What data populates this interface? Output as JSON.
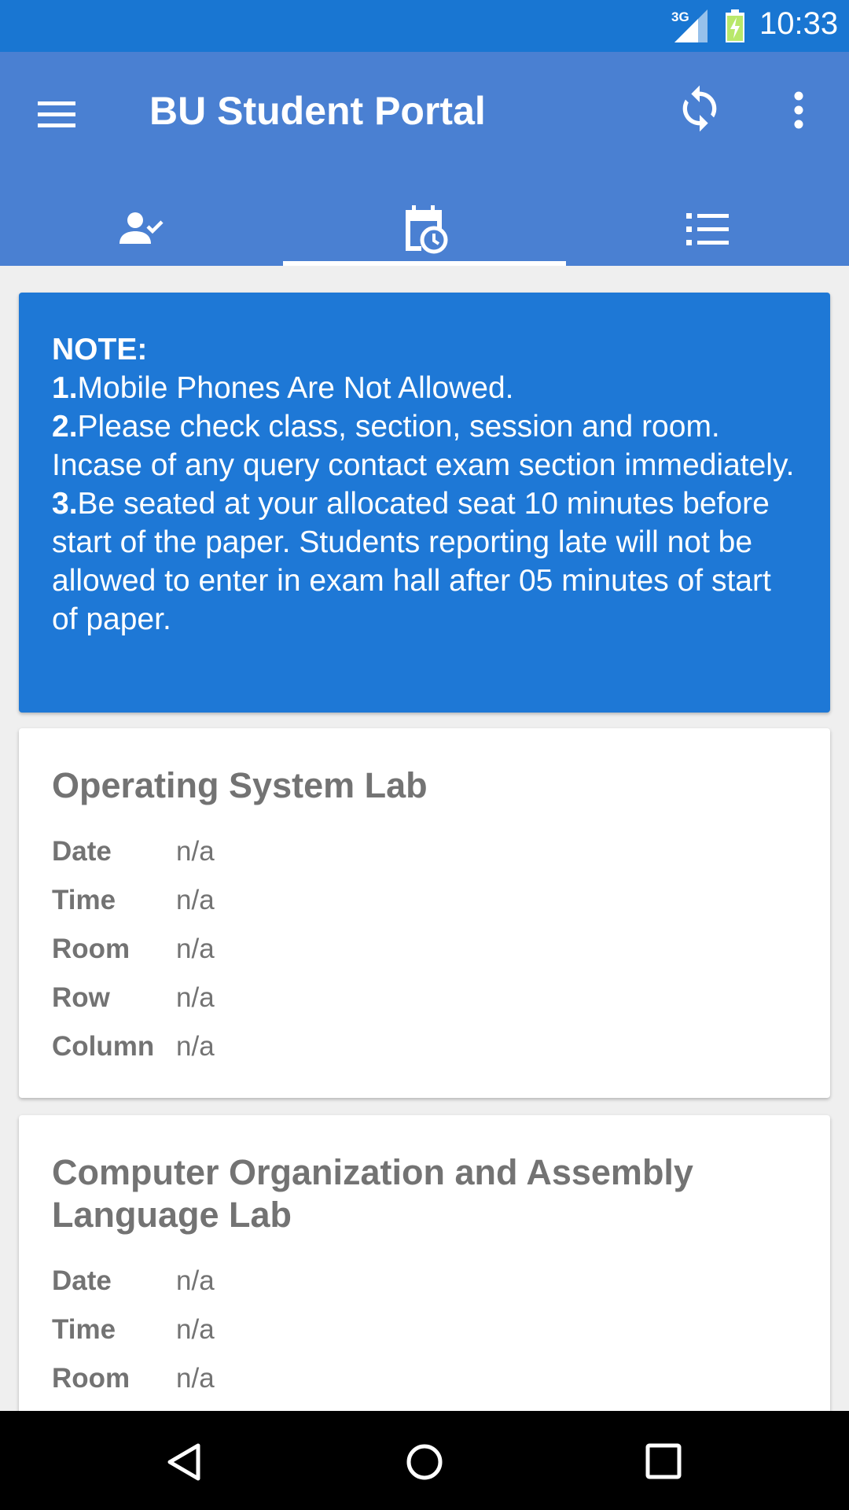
{
  "status_bar": {
    "network_label": "3G",
    "time": "10:33"
  },
  "app_bar": {
    "title": "BU Student Portal",
    "icons": [
      "menu-icon",
      "refresh-icon",
      "more-vert-icon"
    ]
  },
  "tabs": [
    {
      "icon": "person-check-icon",
      "selected": false
    },
    {
      "icon": "calendar-clock-icon",
      "selected": true
    },
    {
      "icon": "list-icon",
      "selected": false
    }
  ],
  "note": {
    "heading": "NOTE:",
    "items": [
      {
        "num": "1.",
        "text": "Mobile Phones Are Not Allowed."
      },
      {
        "num": "2.",
        "text": "Please check class, section, session and room. Incase of any query contact exam section immediately."
      },
      {
        "num": "3.",
        "text": "Be seated at your allocated seat 10 minutes before start of the paper. Students reporting late will not be allowed to enter in exam hall after 05 minutes of start of paper."
      }
    ]
  },
  "exams": [
    {
      "title": "Operating System Lab",
      "fields": [
        {
          "label": "Date",
          "value": "n/a"
        },
        {
          "label": "Time",
          "value": "n/a"
        },
        {
          "label": "Room",
          "value": "n/a"
        },
        {
          "label": "Row",
          "value": "n/a"
        },
        {
          "label": "Column",
          "value": "n/a"
        }
      ]
    },
    {
      "title": "Computer Organization and Assembly Language Lab",
      "fields": [
        {
          "label": "Date",
          "value": "n/a"
        },
        {
          "label": "Time",
          "value": "n/a"
        },
        {
          "label": "Room",
          "value": "n/a"
        }
      ]
    }
  ],
  "colors": {
    "status_bar": "#1976d2",
    "app_bar": "#4a80d2",
    "note_card": "#1e78d6",
    "card_text": "#737373"
  }
}
